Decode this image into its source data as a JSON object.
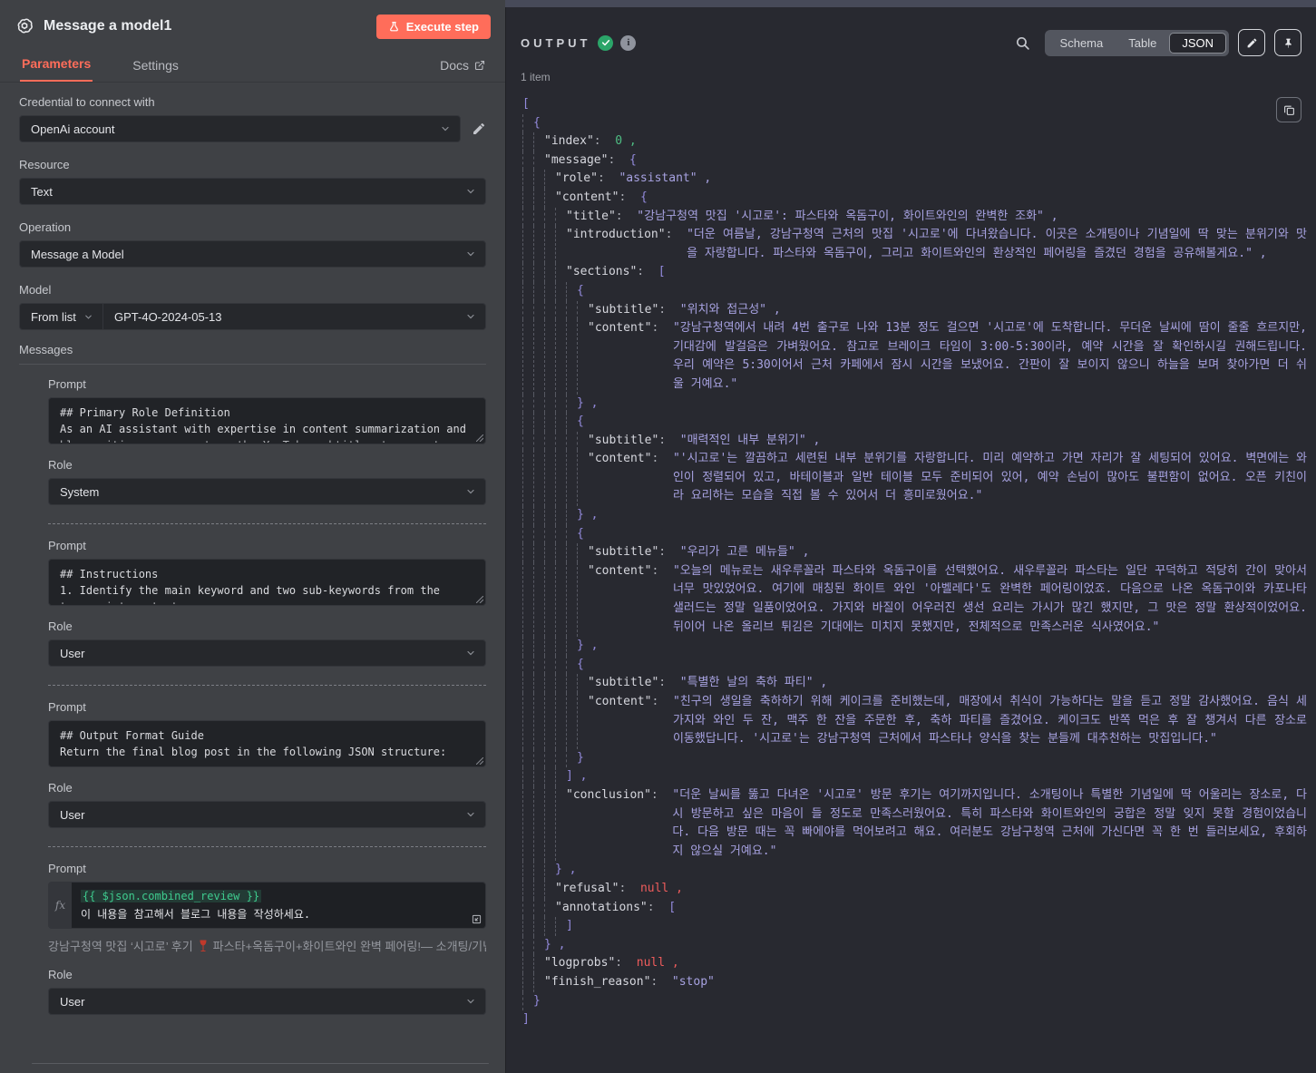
{
  "left_panel": {
    "title": "Message a model1",
    "execute_button": "Execute step",
    "tabs": {
      "parameters": "Parameters",
      "settings": "Settings"
    },
    "docs_link": "Docs",
    "credential_label": "Credential to connect with",
    "credential_value": "OpenAi account",
    "resource_label": "Resource",
    "resource_value": "Text",
    "operation_label": "Operation",
    "operation_value": "Message a Model",
    "model_label": "Model",
    "model_mode": "From list",
    "model_value": "GPT-4O-2024-05-13",
    "messages_label": "Messages",
    "prompt_label": "Prompt",
    "role_label": "Role",
    "messages": [
      {
        "lines": [
          "## Primary Role Definition",
          "As an AI assistant with expertise in content summarization and"
        ],
        "clipped": "blog writing, you can turn the YouTube subtitles to a post",
        "role": "System"
      },
      {
        "lines": [
          "## Instructions",
          "1. Identify the main keyword and two sub-keywords from the"
        ],
        "clipped": "transcript content",
        "role": "User"
      },
      {
        "lines": [
          "## Output Format Guide",
          "Return the final blog post in the following JSON structure:"
        ],
        "clipped": "",
        "role": "User"
      },
      {
        "expression": "{{ $json.combined_review }}",
        "expression_line2": "이 내용을 참고해서 블로그 내용을 작성하세요.",
        "preview_prefix": "강남구청역 맛집 ‘시고로’ 후기",
        "preview_suffix": "파스타+옥돔구이+화이트와인 완벽 페어링!— 소개팅/기념일 추천 ...",
        "role": "User"
      }
    ]
  },
  "output_panel": {
    "title": "OUTPUT",
    "items_count": "1 item",
    "view_tabs": {
      "schema": "Schema",
      "table": "Table",
      "json": "JSON"
    },
    "active_tab": "JSON",
    "colors": {
      "accent": "#ff6d5a",
      "success": "#2ba569",
      "string": "#a7a2e1",
      "number": "#4fbf84",
      "null": "#ee5c5c"
    },
    "json_lines": [
      {
        "l": 0,
        "b": "["
      },
      {
        "l": 1,
        "b": "{"
      },
      {
        "l": 2,
        "k": "index",
        "t": "n",
        "v": "0",
        "c": 1
      },
      {
        "l": 2,
        "k": "message",
        "b": "{"
      },
      {
        "l": 3,
        "k": "role",
        "t": "s",
        "v": "assistant",
        "c": 1
      },
      {
        "l": 3,
        "k": "content",
        "b": "{"
      },
      {
        "l": 4,
        "k": "title",
        "t": "s",
        "v": "강남구청역 맛집 '시고로': 파스타와 옥돔구이, 화이트와인의 완벽한 조화",
        "c": 1
      },
      {
        "l": 4,
        "k": "introduction",
        "t": "s",
        "v": "더운 여름날, 강남구청역 근처의 맛집 '시고로'에 다녀왔습니다. 이곳은 소개팅이나 기념일에 딱 맞는 분위기와 맛을 자랑합니다. 파스타와 옥돔구이, 그리고 화이트와인의 환상적인 페어링을 즐겼던 경험을 공유해볼게요.",
        "c": 1
      },
      {
        "l": 4,
        "k": "sections",
        "b": "["
      },
      {
        "l": 5,
        "b": "{"
      },
      {
        "l": 6,
        "k": "subtitle",
        "t": "s",
        "v": "위치와 접근성",
        "c": 1
      },
      {
        "l": 6,
        "k": "content",
        "t": "s",
        "v": "강남구청역에서 내려 4번 출구로 나와 13분 정도 걸으면 '시고로'에 도착합니다. 무더운 날씨에 땀이 줄줄 흐르지만, 기대감에 발걸음은 가벼웠어요. 참고로 브레이크 타임이 3:00-5:30이라, 예약 시간을 잘 확인하시길 권해드립니다. 우리 예약은 5:30이어서 근처 카페에서 잠시 시간을 보냈어요. 간판이 잘 보이지 않으니 하늘을 보며 찾아가면 더 쉬울 거예요."
      },
      {
        "l": 5,
        "b": "}",
        "c": 1
      },
      {
        "l": 5,
        "b": "{"
      },
      {
        "l": 6,
        "k": "subtitle",
        "t": "s",
        "v": "매력적인 내부 분위기",
        "c": 1
      },
      {
        "l": 6,
        "k": "content",
        "t": "s",
        "v": "'시고로'는 깔끔하고 세련된 내부 분위기를 자랑합니다. 미리 예약하고 가면 자리가 잘 세팅되어 있어요. 벽면에는 와인이 정렬되어 있고, 바테이블과 일반 테이블 모두 준비되어 있어, 예약 손님이 많아도 불편함이 없어요. 오픈 키친이라 요리하는 모습을 직접 볼 수 있어서 더 흥미로웠어요."
      },
      {
        "l": 5,
        "b": "}",
        "c": 1
      },
      {
        "l": 5,
        "b": "{"
      },
      {
        "l": 6,
        "k": "subtitle",
        "t": "s",
        "v": "우리가 고른 메뉴들",
        "c": 1
      },
      {
        "l": 6,
        "k": "content",
        "t": "s",
        "v": "오늘의 메뉴로는 새우루꼴라 파스타와 옥돔구이를 선택했어요. 새우루꼴라 파스타는 일단 꾸덕하고 적당히 간이 맞아서 너무 맛있었어요. 여기에 매칭된 화이트 와인 '아벨레다'도 완벽한 페어링이었죠. 다음으로 나온 옥돔구이와 카포나타 샐러드는 정말 일품이었어요. 가지와 바질이 어우러진 생선 요리는 가시가 많긴 했지만, 그 맛은 정말 환상적이었어요. 뒤이어 나온 올리브 튀김은 기대에는 미치지 못했지만, 전체적으로 만족스러운 식사였어요."
      },
      {
        "l": 5,
        "b": "}",
        "c": 1
      },
      {
        "l": 5,
        "b": "{"
      },
      {
        "l": 6,
        "k": "subtitle",
        "t": "s",
        "v": "특별한 날의 축하 파티",
        "c": 1
      },
      {
        "l": 6,
        "k": "content",
        "t": "s",
        "v": "친구의 생일을 축하하기 위해 케이크를 준비했는데, 매장에서 취식이 가능하다는 말을 듣고 정말 감사했어요. 음식 세 가지와 와인 두 잔, 맥주 한 잔을 주문한 후, 축하 파티를 즐겼어요. 케이크도 반쪽 먹은 후 잘 챙겨서 다른 장소로 이동했답니다. '시고로'는 강남구청역 근처에서 파스타나 양식을 찾는 분들께 대추천하는 맛집입니다."
      },
      {
        "l": 5,
        "b": "}"
      },
      {
        "l": 4,
        "b": "]",
        "c": 1
      },
      {
        "l": 4,
        "k": "conclusion",
        "t": "s",
        "v": "더운 날씨를 뚫고 다녀온 '시고로' 방문 후기는 여기까지입니다. 소개팅이나 특별한 기념일에 딱 어울리는 장소로, 다시 방문하고 싶은 마음이 들 정도로 만족스러웠어요. 특히 파스타와 화이트와인의 궁합은 정말 잊지 못할 경험이었습니다. 다음 방문 때는 꼭 빠에야를 먹어보려고 해요. 여러분도 강남구청역 근처에 가신다면 꼭 한 번 들러보세요, 후회하지 않으실 거예요."
      },
      {
        "l": 3,
        "b": "}",
        "c": 1
      },
      {
        "l": 3,
        "k": "refusal",
        "t": "x",
        "v": "null",
        "c": 1
      },
      {
        "l": 3,
        "k": "annotations",
        "b": "["
      },
      {
        "l": 4,
        "b": "]"
      },
      {
        "l": 2,
        "b": "}",
        "c": 1
      },
      {
        "l": 2,
        "k": "logprobs",
        "t": "x",
        "v": "null",
        "c": 1
      },
      {
        "l": 2,
        "k": "finish_reason",
        "t": "s",
        "v": "stop"
      },
      {
        "l": 1,
        "b": "}"
      },
      {
        "l": 0,
        "b": "]"
      }
    ]
  }
}
